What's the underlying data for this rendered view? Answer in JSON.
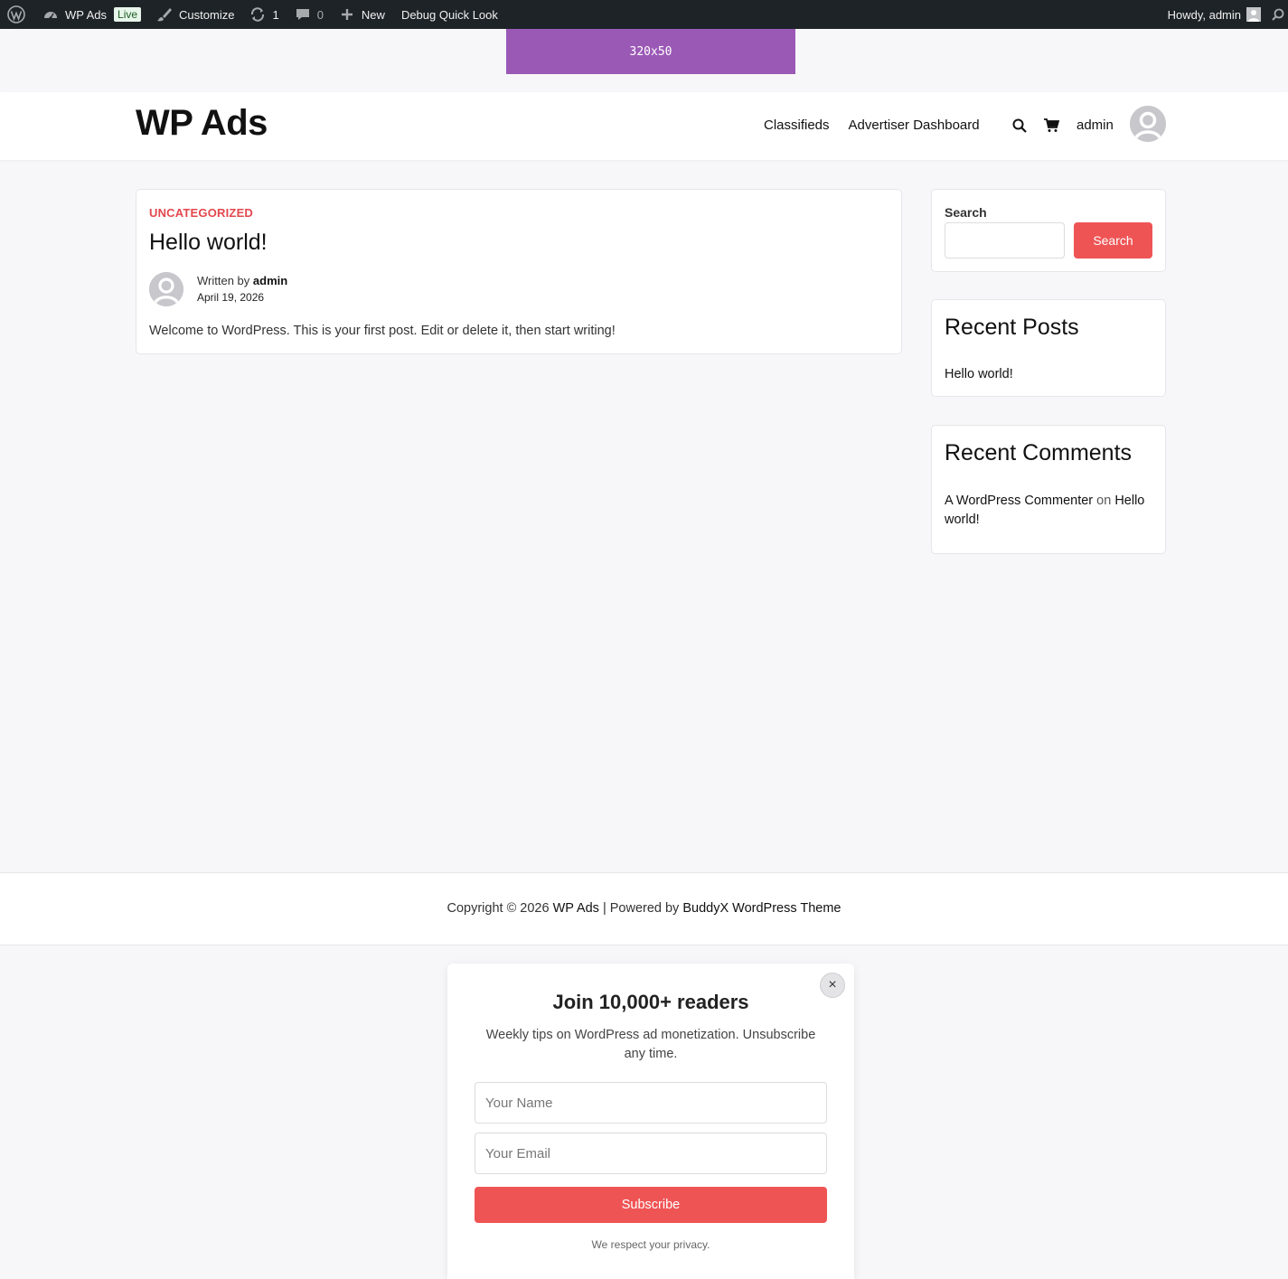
{
  "admin_bar": {
    "site_name": "WP Ads",
    "live_badge": "Live",
    "customize": "Customize",
    "updates_count": "1",
    "comments_count": "0",
    "new": "New",
    "debug": "Debug Quick Look",
    "howdy": "Howdy, admin"
  },
  "ad_banner": {
    "label": "320x50",
    "color": "#9b59b6"
  },
  "header": {
    "site_title": "WP Ads",
    "nav": [
      "Classifieds",
      "Advertiser Dashboard"
    ],
    "user_name": "admin"
  },
  "post": {
    "category": "UNCATEGORIZED",
    "title": "Hello world!",
    "written_by": "Written by",
    "author": "admin",
    "date": "April 19, 2026",
    "excerpt": "Welcome to WordPress. This is your first post. Edit or delete it, then start writing!"
  },
  "sidebar": {
    "search": {
      "label": "Search",
      "value": "",
      "button": "Search"
    },
    "recent_posts": {
      "title": "Recent Posts",
      "items": [
        "Hello world!"
      ]
    },
    "recent_comments": {
      "title": "Recent Comments",
      "commenter": "A WordPress Commenter",
      "on": "on",
      "post": "Hello world!"
    }
  },
  "footer": {
    "copyright": "Copyright © 2026",
    "site": "WP Ads",
    "powered_by": "| Powered by",
    "theme": "BuddyX WordPress Theme"
  },
  "popup": {
    "title": "Join 10,000+ readers",
    "description": "Weekly tips on WordPress ad monetization. Unsubscribe any time.",
    "name_placeholder": "Your Name",
    "email_placeholder": "Your Email",
    "subscribe": "Subscribe",
    "privacy": "We respect your privacy.",
    "close": "×"
  },
  "colors": {
    "accent": "#ef5455",
    "category": "#e2484e",
    "admin_bar": "#1d2327"
  }
}
